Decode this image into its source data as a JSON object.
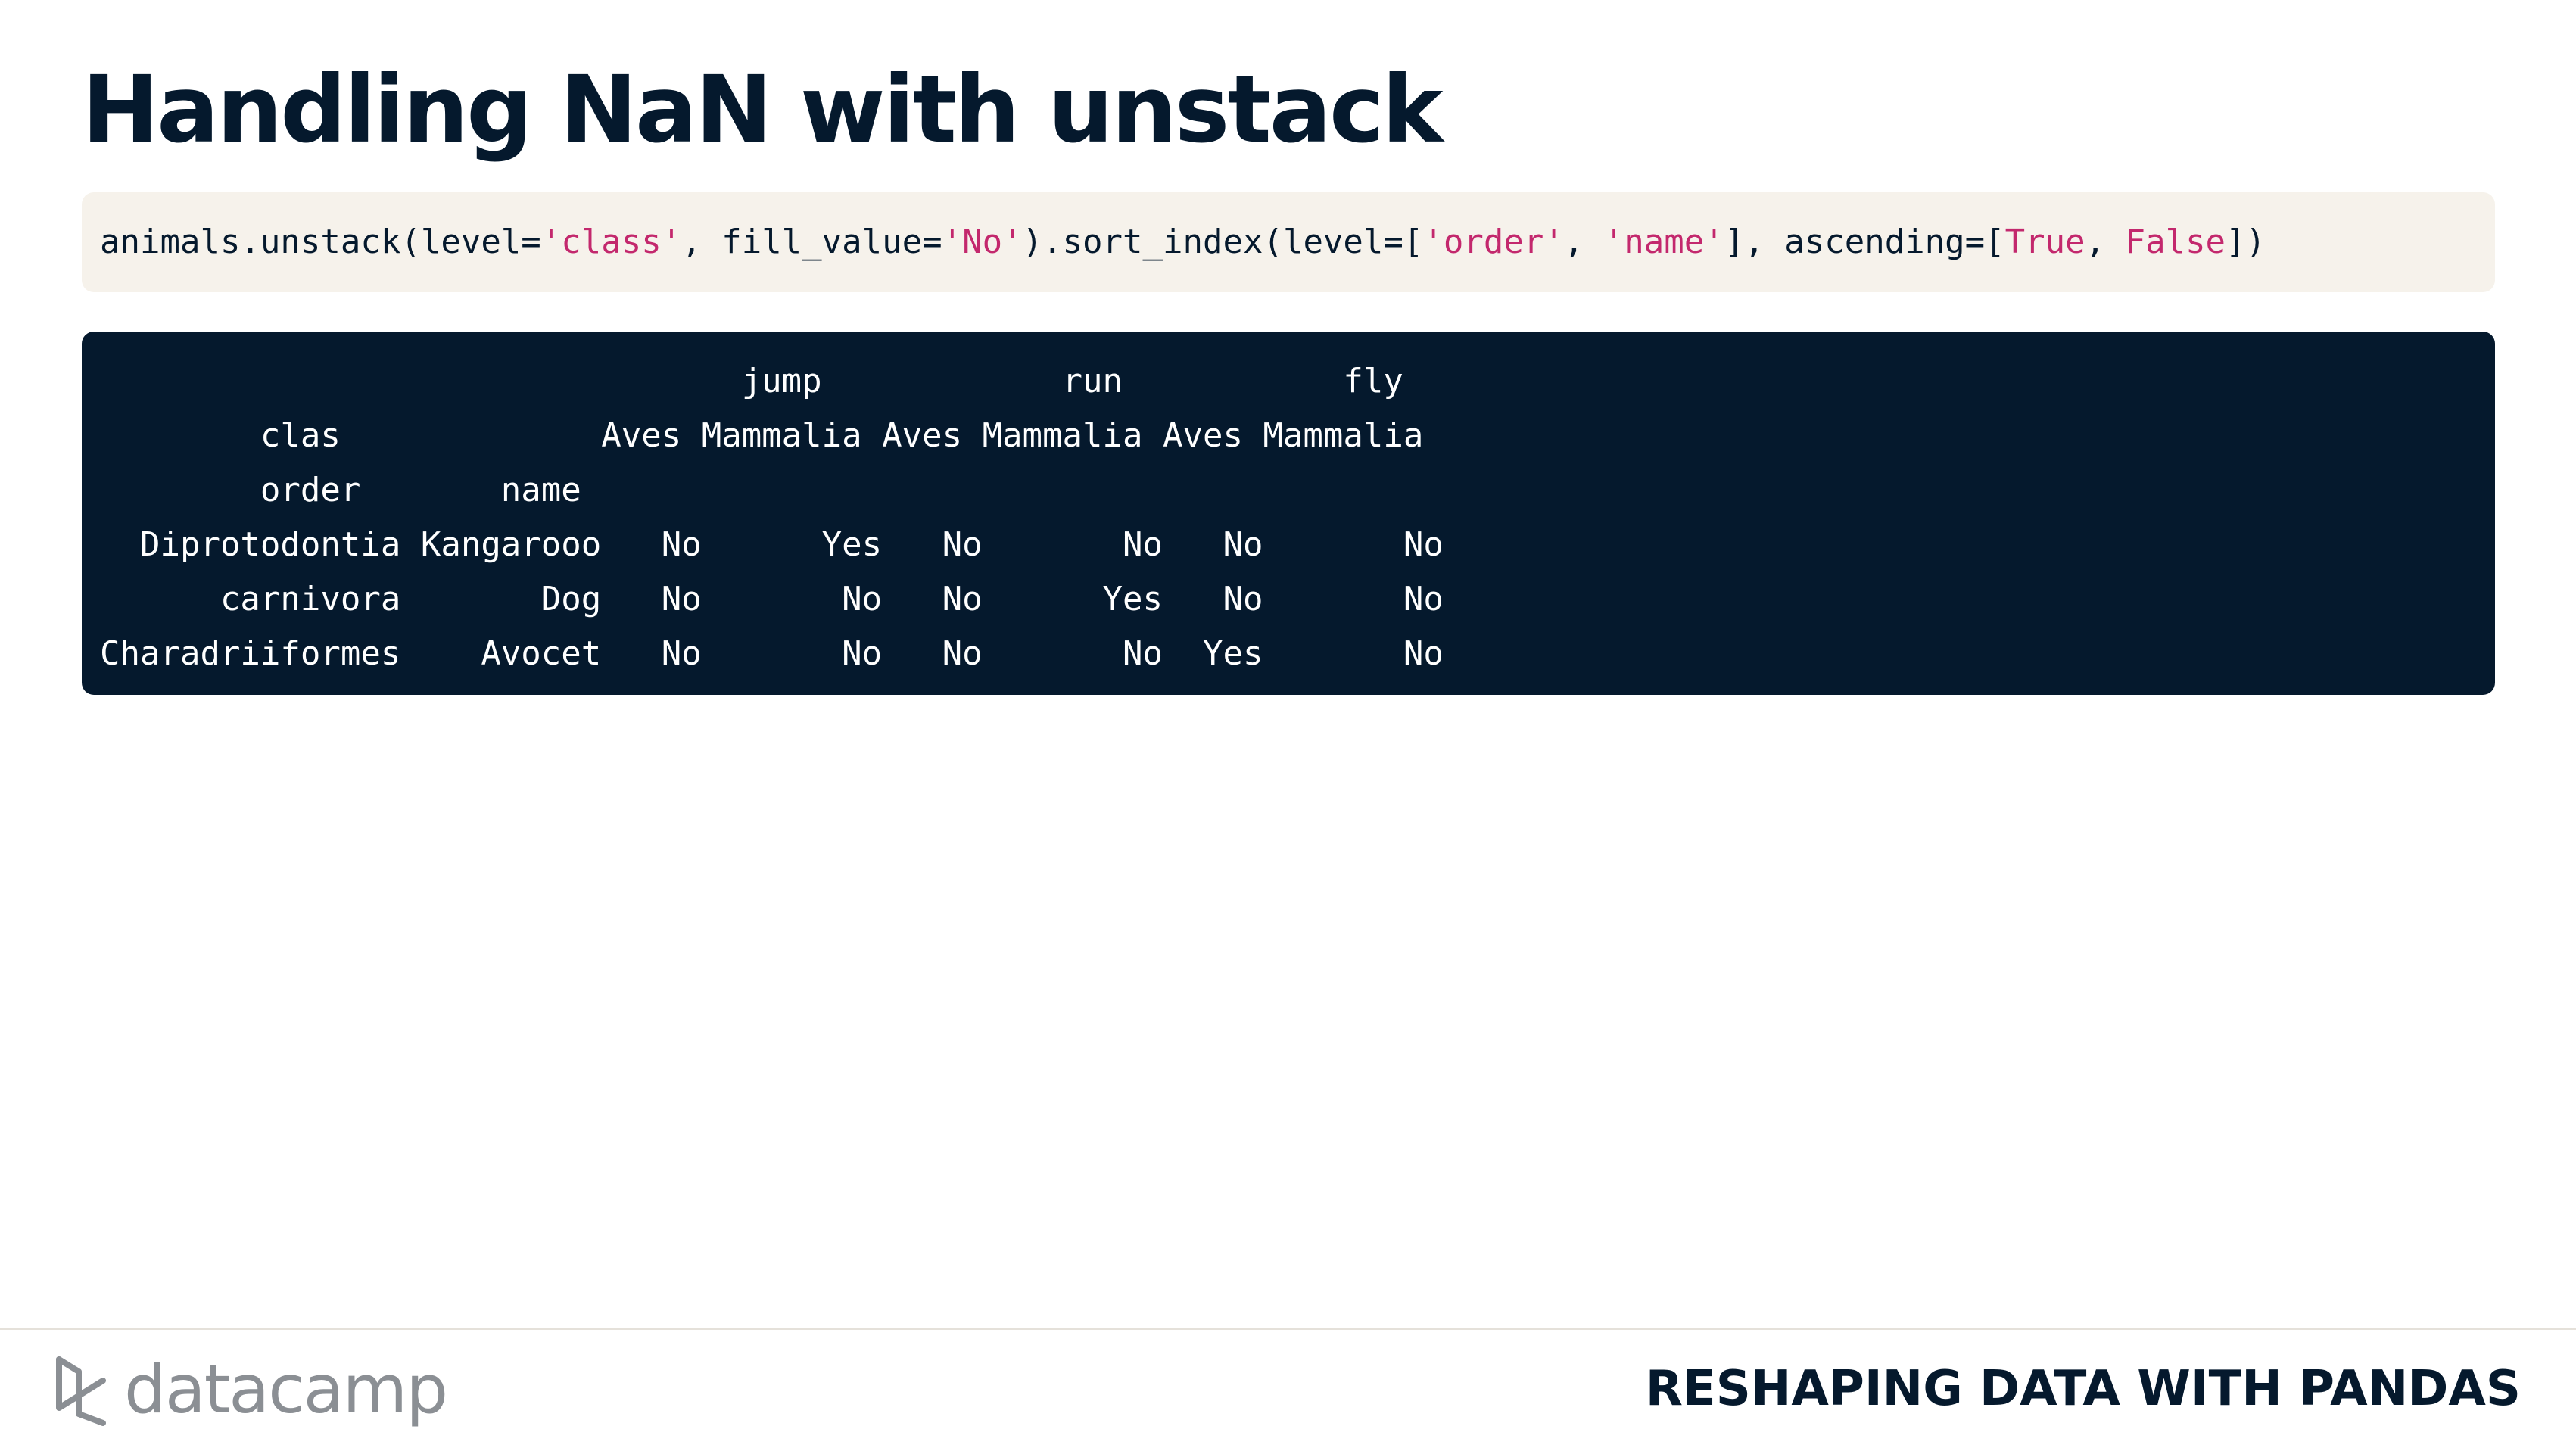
{
  "slide": {
    "title": "Handling NaN with unstack",
    "course_title": "RESHAPING DATA WITH PANDAS",
    "brand": "datacamp"
  },
  "code": {
    "t1": "animals.unstack(level=",
    "s1": "'class'",
    "t2": ", fill_value=",
    "s2": "'No'",
    "t3": ").sort_index(level=[",
    "s3": "'order'",
    "t4": ", ",
    "s4": "'name'",
    "t5": "], ascending=[",
    "k1": "True",
    "t6": ", ",
    "k2": "False",
    "t7": "])"
  },
  "output": {
    "lines": [
      "                                jump            run           fly",
      "        clas             Aves Mammalia Aves Mammalia Aves Mammalia",
      "        order       name",
      "  Diprotodontia Kangarooo   No      Yes   No       No   No       No",
      "      carnivora       Dog   No       No   No      Yes   No       No",
      "Charadriiformes    Avocet   No       No   No       No  Yes       No"
    ]
  },
  "colors": {
    "title": "#05192d",
    "code_bg": "#f6f2eb",
    "output_bg": "#05192d",
    "string": "#c3286d",
    "logo": "#8b8f94"
  }
}
